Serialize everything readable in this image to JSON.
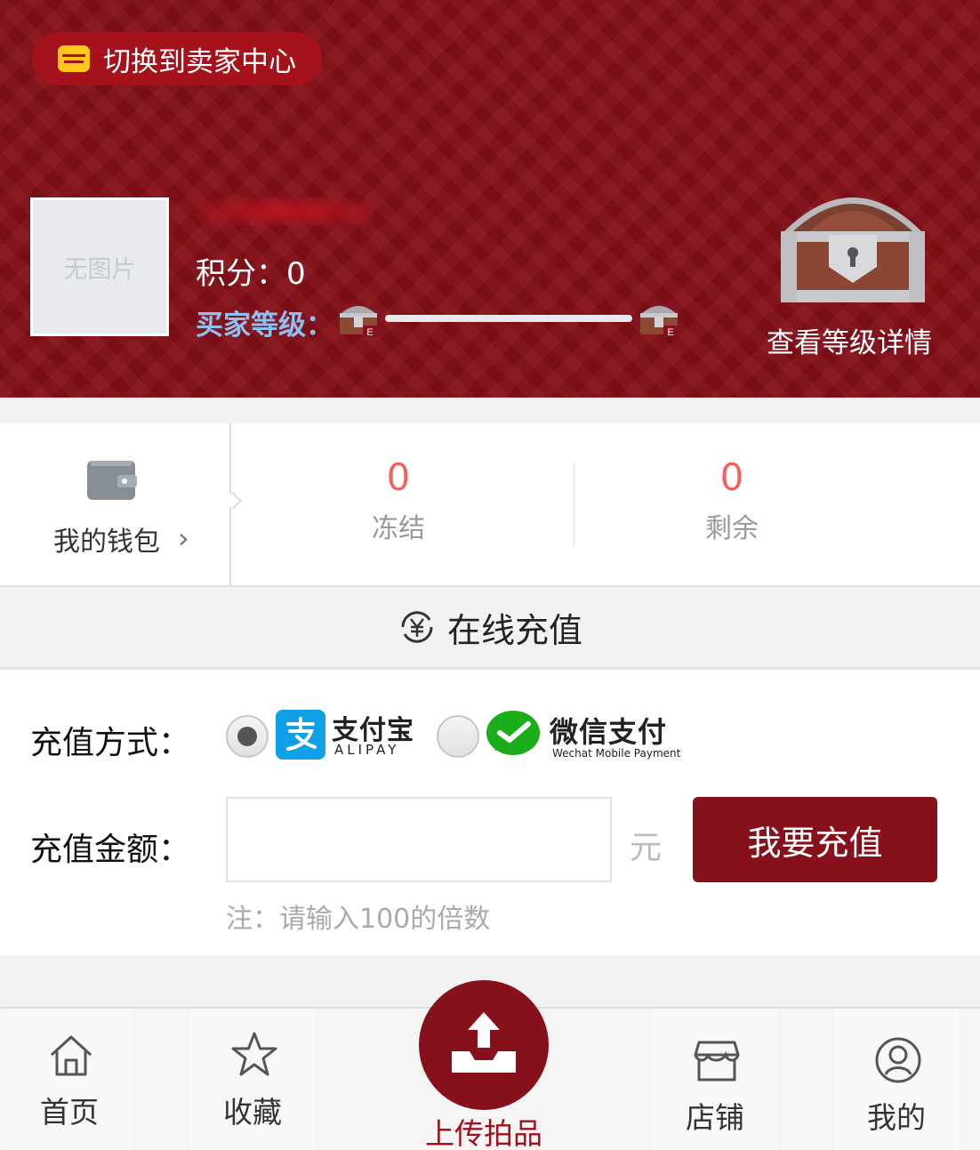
{
  "header": {
    "switch_label": "切换到卖家中心",
    "avatar_placeholder": "无图片",
    "score_label": "积分：0",
    "level_label": "买家等级：",
    "level_from": "E",
    "level_to": "E",
    "level_detail": "查看等级详情"
  },
  "wallet": {
    "label": "我的钱包",
    "chevron": "›",
    "frozen_value": "0",
    "frozen_label": "冻结",
    "remain_value": "0",
    "remain_label": "剩余"
  },
  "recharge": {
    "title": "在线充值",
    "method_label": "充值方式：",
    "alipay_cn": "支付宝",
    "alipay_en": "ALIPAY",
    "wechat_cn": "微信支付",
    "wechat_en": "Wechat Mobile Payment",
    "selected_method": "alipay",
    "amount_label": "充值金额：",
    "amount_value": "",
    "unit": "元",
    "submit_label": "我要充值",
    "note": "注：请输入100的倍数"
  },
  "nav": {
    "home": "首页",
    "favorites": "收藏",
    "upload": "上传拍品",
    "shop": "店铺",
    "mine": "我的"
  },
  "colors": {
    "brand": "#86101b",
    "stat_number": "#f06262",
    "level_label": "#8ec1f0",
    "alipay_blue": "#0ea1e8",
    "wechat_green": "#1aad19"
  }
}
